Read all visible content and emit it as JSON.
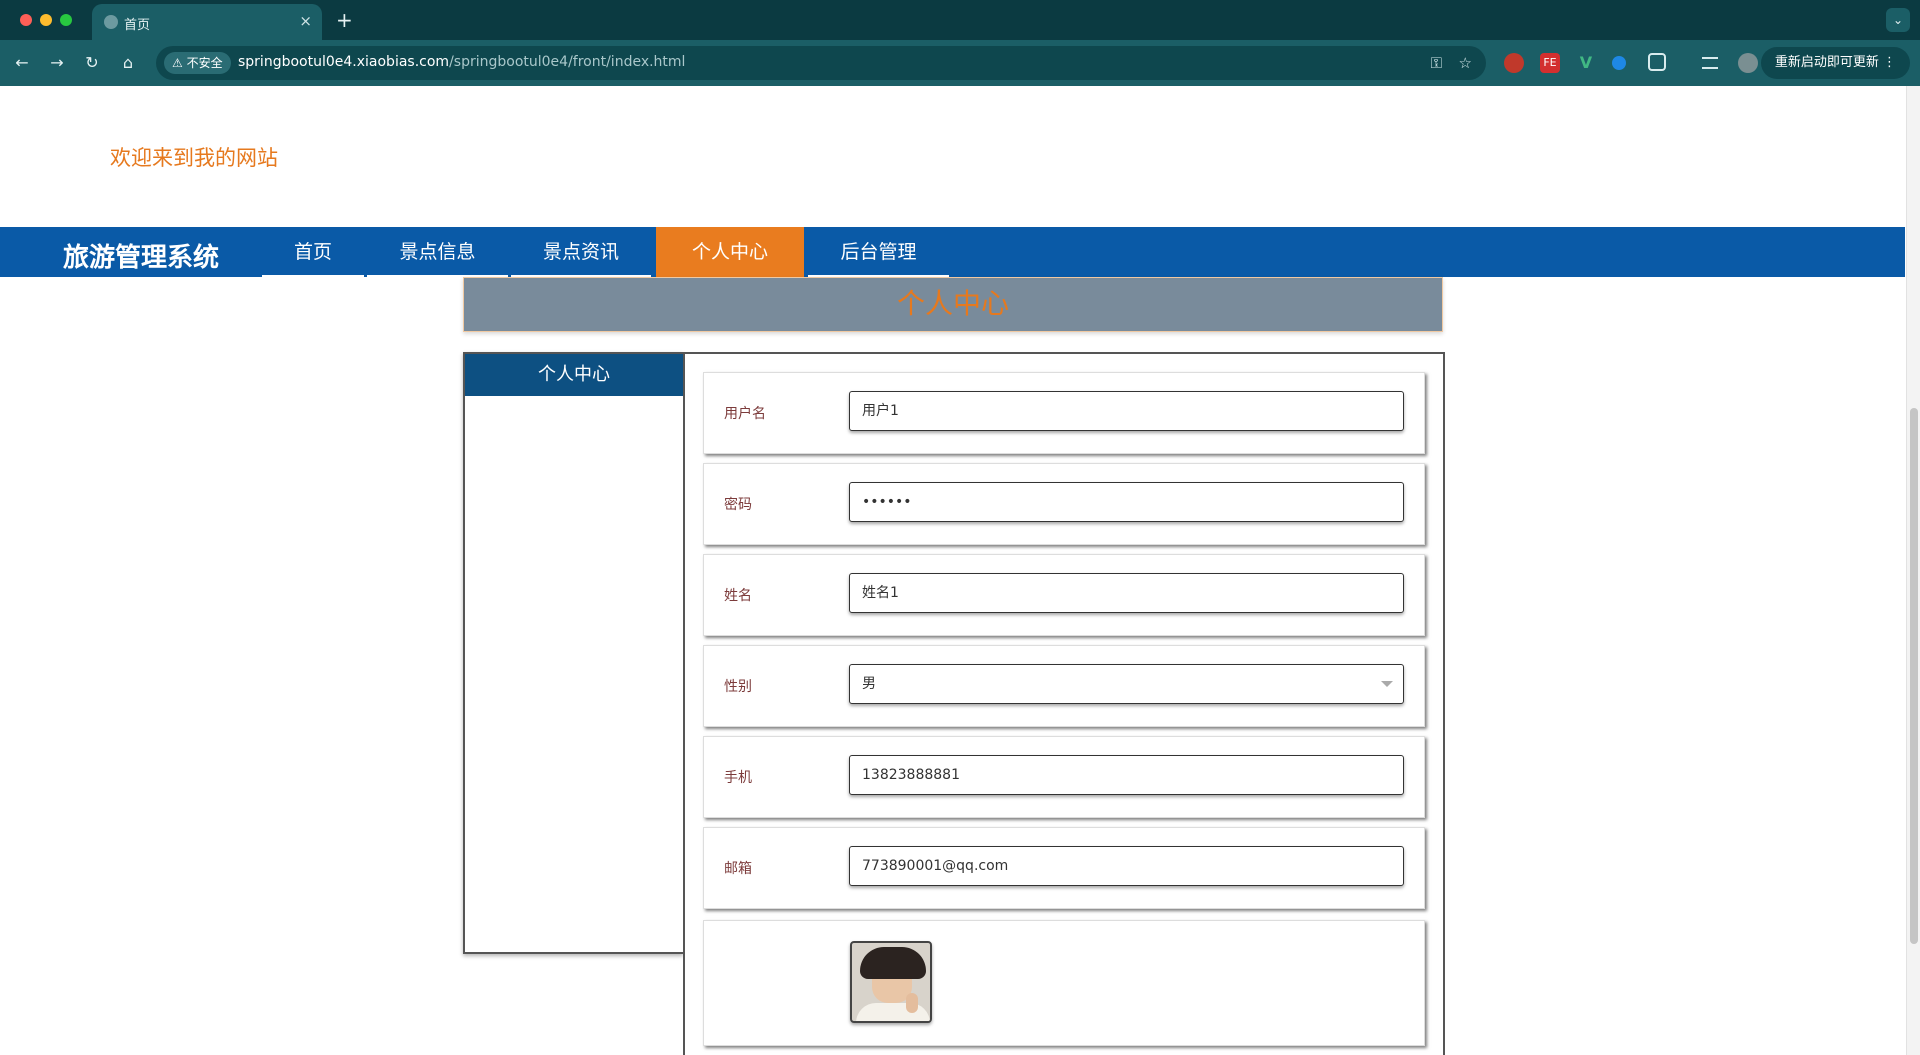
{
  "browser": {
    "tab_title": "首页",
    "tab_close": "×",
    "new_tab": "+",
    "tab_menu": "⌄",
    "back": "←",
    "forward": "→",
    "reload": "↻",
    "home": "⌂",
    "security_label": "⚠ 不安全",
    "url_host": "springbootul0e4.xiaobias.com",
    "url_path": "/springbootul0e4/front/index.html",
    "key_icon": "⚿",
    "star_icon": "☆",
    "ext_fe": "FE",
    "ext_v": "V",
    "restart_label": "重新启动即可更新 ⋮"
  },
  "site": {
    "welcome": "欢迎来到我的网站",
    "brand": "旅游管理系统",
    "nav": {
      "home": "首页",
      "spots": "景点信息",
      "news": "景点资讯",
      "personal": "个人中心",
      "admin": "后台管理"
    },
    "banner_title": "个人中心",
    "sidebar_title": "个人中心"
  },
  "form": {
    "username": {
      "label": "用户名",
      "value": "用户1"
    },
    "password": {
      "label": "密码",
      "value": "••••••"
    },
    "name": {
      "label": "姓名",
      "value": "姓名1"
    },
    "gender": {
      "label": "性别",
      "value": "男"
    },
    "phone": {
      "label": "手机",
      "value": "13823888881"
    },
    "email": {
      "label": "邮箱",
      "value": "773890001@qq.com"
    }
  },
  "colors": {
    "brand_orange": "#e6791e",
    "nav_blue": "#0a5aa7",
    "sidebar_head": "#0d5082",
    "banner_bg": "#798b9b"
  }
}
